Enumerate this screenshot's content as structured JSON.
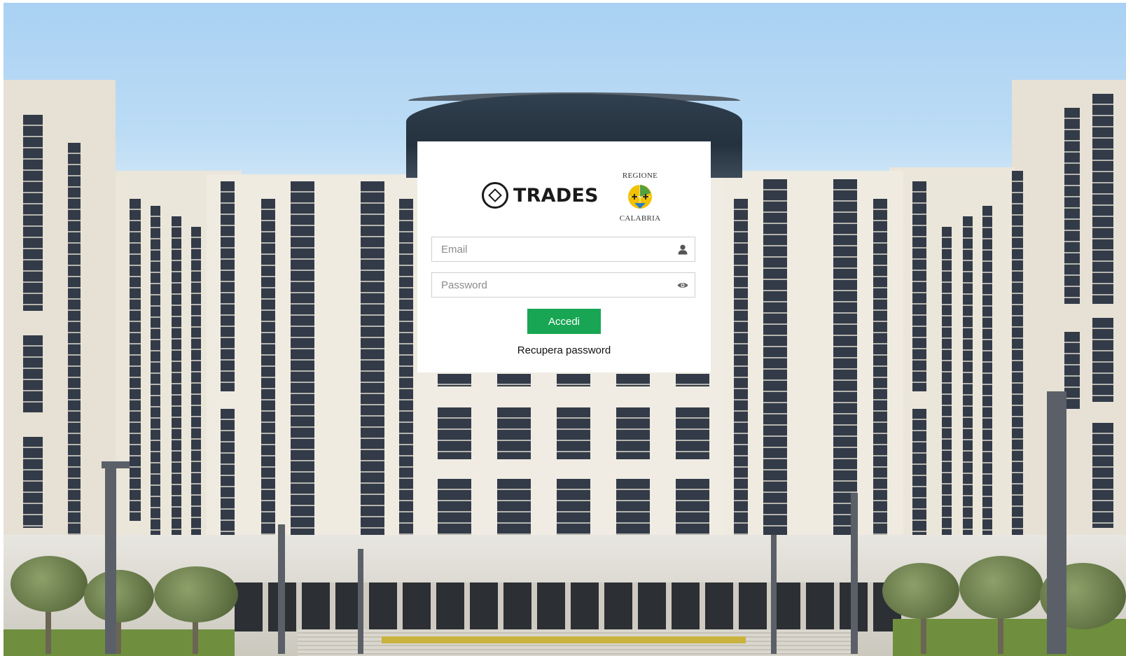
{
  "brand": {
    "name": "TRADES"
  },
  "region_logo": {
    "top_text": "REGIONE",
    "bottom_text": "CALABRIA",
    "colors": {
      "shield": "#f2c200",
      "cross": "#1b1b1b",
      "blue": "#2a7bc4",
      "green": "#3a9a4a"
    }
  },
  "form": {
    "email_placeholder": "Email",
    "email_value": "",
    "password_placeholder": "Password",
    "password_value": "",
    "submit_label": "Accedi",
    "recover_label": "Recupera password"
  },
  "icons": {
    "email": "user-icon",
    "password": "eye-icon",
    "brand": "diamond-circle-logo-icon"
  },
  "theme": {
    "accent": "#18a654",
    "card_bg": "#ffffff",
    "input_border": "#cfcfcf"
  }
}
